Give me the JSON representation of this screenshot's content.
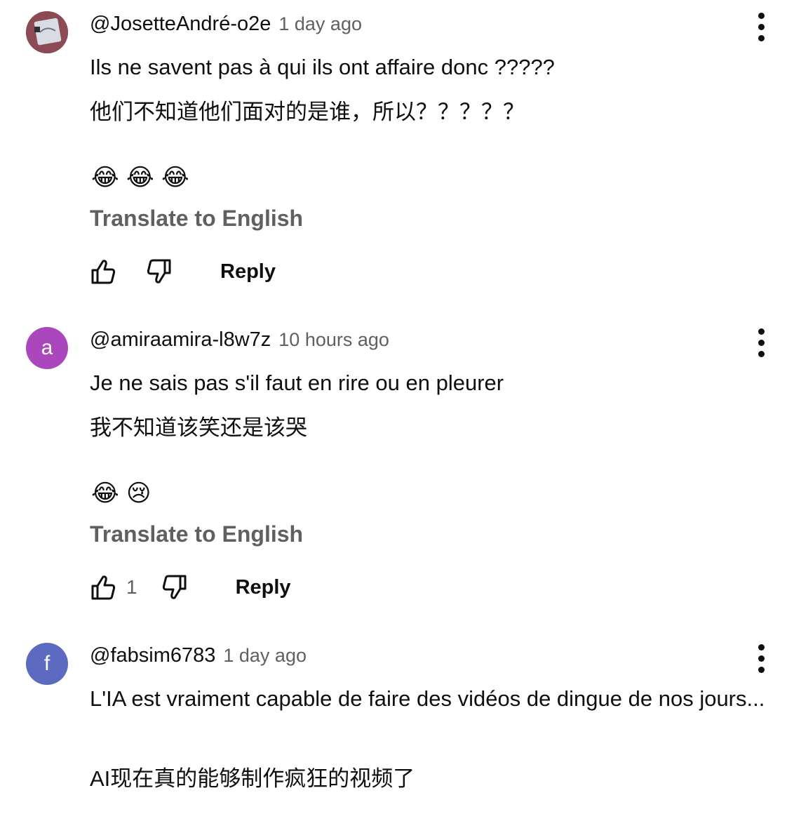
{
  "comments": [
    {
      "author": "@JosetteAndré-o2e",
      "time": "1 day ago",
      "avatar_letter": "",
      "avatar_color": "#8c4a55",
      "text_fr": "Ils ne savent pas à qui ils ont affaire donc ?????",
      "text_zh": "他们不知道他们面对的是谁，所以？？？？？",
      "emojis": [
        "😂",
        "😂",
        "😂"
      ],
      "translate_label": "Translate to English",
      "like_count": "",
      "reply_label": "Reply"
    },
    {
      "author": "@amiraamira-l8w7z",
      "time": "10 hours ago",
      "avatar_letter": "a",
      "avatar_color": "#ab47bc",
      "text_fr": "Je ne sais pas s'il faut en rire ou en pleurer",
      "text_zh": "我不知道该笑还是该哭",
      "emojis": [
        "😂",
        "😢"
      ],
      "translate_label": "Translate to English",
      "like_count": "1",
      "reply_label": "Reply"
    },
    {
      "author": "@fabsim6783",
      "time": "1 day ago",
      "avatar_letter": "f",
      "avatar_color": "#5c6bc0",
      "text_fr": "L'IA est vraiment capable de faire des vidéos de dingue de nos jours...",
      "text_zh": "AI现在真的能够制作疯狂的视频了"
    }
  ]
}
